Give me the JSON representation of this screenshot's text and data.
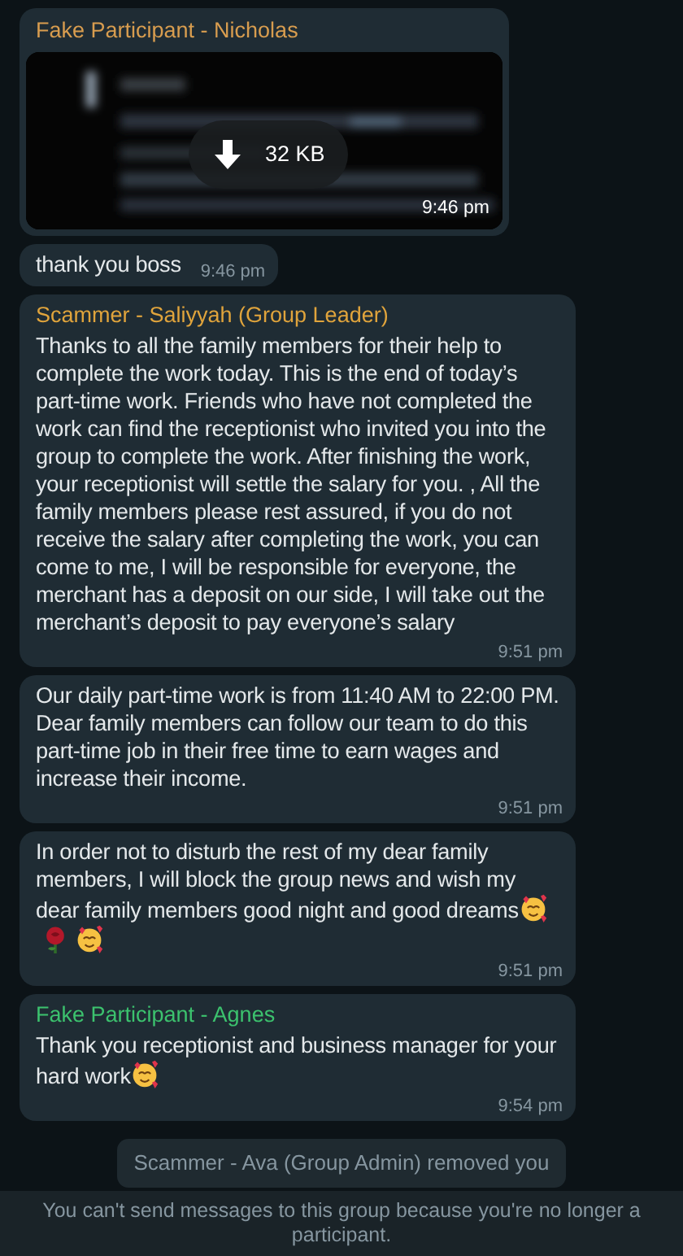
{
  "messages": [
    {
      "sender": "Fake Participant - Nicholas",
      "color": "#d89d4f",
      "size": "32 KB",
      "time": "9:46 pm"
    },
    {
      "kind": "text",
      "text": "thank you boss",
      "time": "9:46 pm"
    },
    {
      "kind": "text",
      "sender": "Scammer - Saliyyah (Group Leader)",
      "color": "#e0a43c",
      "text": "Thanks to all the family members for their help to complete the work today. This is the end of today’s part-time work. Friends who have not completed the work can find the receptionist who invited you into the group to complete the work. After finishing the work, your receptionist will settle the salary for you. , All the family members please rest assured, if you do not receive the salary after completing the work, you can come to me, I will be responsible for everyone, the merchant has a deposit on our side, I will take out the merchant’s deposit to pay everyone’s salary",
      "time": "9:51 pm"
    },
    {
      "kind": "text",
      "text": "Our daily part-time work is from 11:40 AM to 22:00 PM. Dear family members can follow our team to do this part-time job in their free time to earn wages and increase their income.",
      "time": "9:51 pm"
    },
    {
      "kind": "text",
      "text": "In order not to disturb the rest of my dear family members, I will block the group news and wish my dear family members good night and good dreams",
      "emojis": [
        {
          "kind": "smiling-hearts"
        },
        {
          "kind": "rose"
        },
        {
          "kind": "smiling-hearts"
        }
      ],
      "time": "9:51 pm"
    },
    {
      "kind": "text",
      "sender": "Fake Participant - Agnes",
      "color": "#3cc26e",
      "text": "Thank you receptionist and business manager for your hard work",
      "emojis": [
        {
          "kind": "smiling-hearts"
        }
      ],
      "time": "9:54 pm"
    },
    {
      "kind": "system",
      "text": "Scammer - Ava (Group Admin) removed you"
    }
  ],
  "footer": "You can't send messages to this group because you're no longer a participant."
}
